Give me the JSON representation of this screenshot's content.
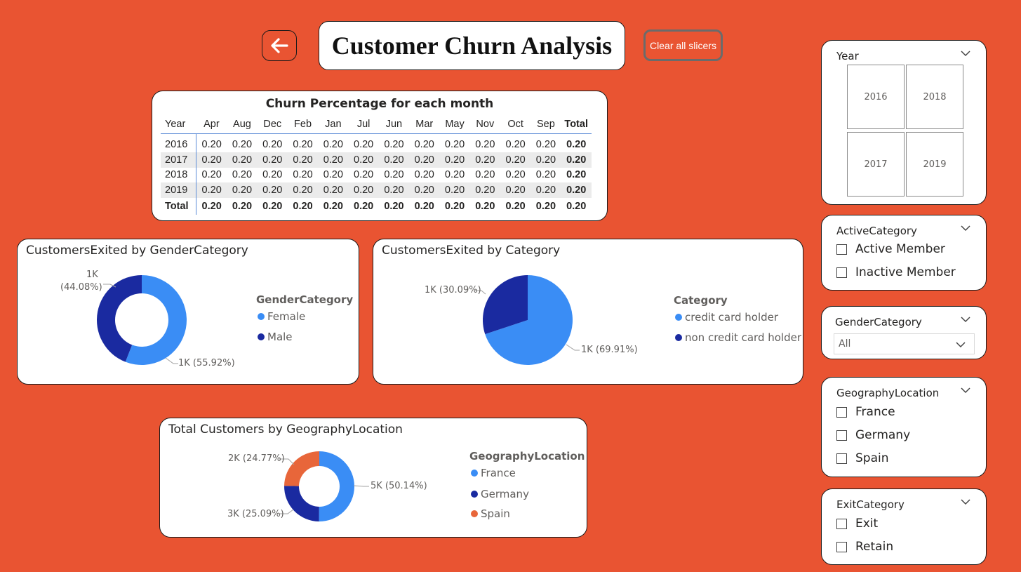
{
  "header": {
    "back_icon": "arrow-left-icon",
    "title": "Customer Churn Analysis",
    "clear_label": "Clear all slicers"
  },
  "matrix": {
    "title": "Churn Percentage for each month",
    "columns": [
      "Year",
      "Apr",
      "Aug",
      "Dec",
      "Feb",
      "Jan",
      "Jul",
      "Jun",
      "Mar",
      "May",
      "Nov",
      "Oct",
      "Sep",
      "Total"
    ],
    "rows": [
      {
        "label": "2016",
        "values": [
          "0.20",
          "0.20",
          "0.20",
          "0.20",
          "0.20",
          "0.20",
          "0.20",
          "0.20",
          "0.20",
          "0.20",
          "0.20",
          "0.20",
          "0.20"
        ]
      },
      {
        "label": "2017",
        "values": [
          "0.20",
          "0.20",
          "0.20",
          "0.20",
          "0.20",
          "0.20",
          "0.20",
          "0.20",
          "0.20",
          "0.20",
          "0.20",
          "0.20",
          "0.20"
        ]
      },
      {
        "label": "2018",
        "values": [
          "0.20",
          "0.20",
          "0.20",
          "0.20",
          "0.20",
          "0.20",
          "0.20",
          "0.20",
          "0.20",
          "0.20",
          "0.20",
          "0.20",
          "0.20"
        ]
      },
      {
        "label": "2019",
        "values": [
          "0.20",
          "0.20",
          "0.20",
          "0.20",
          "0.20",
          "0.20",
          "0.20",
          "0.20",
          "0.20",
          "0.20",
          "0.20",
          "0.20",
          "0.20"
        ]
      }
    ],
    "total_row": {
      "label": "Total",
      "values": [
        "0.20",
        "0.20",
        "0.20",
        "0.20",
        "0.20",
        "0.20",
        "0.20",
        "0.20",
        "0.20",
        "0.20",
        "0.20",
        "0.20",
        "0.20"
      ]
    }
  },
  "chart_data": [
    {
      "type": "pie",
      "variant": "donut",
      "title": "CustomersExited by GenderCategory",
      "legend_title": "GenderCategory",
      "categories": [
        "Female",
        "Male"
      ],
      "values": [
        55.92,
        44.08
      ],
      "data_labels": [
        "1K (55.92%)",
        "1K (44.08%)"
      ],
      "colors": [
        "#3A8DF5",
        "#1A2AA0"
      ]
    },
    {
      "type": "pie",
      "title": "CustomersExited by Category",
      "legend_title": "Category",
      "categories": [
        "credit card holder",
        "non credit card holder"
      ],
      "values": [
        69.91,
        30.09
      ],
      "data_labels": [
        "1K (69.91%)",
        "1K (30.09%)"
      ],
      "colors": [
        "#3A8DF5",
        "#1A2AA0"
      ]
    },
    {
      "type": "pie",
      "variant": "donut",
      "title": "Total Customers by GeographyLocation",
      "legend_title": "GeographyLocation",
      "categories": [
        "France",
        "Germany",
        "Spain"
      ],
      "values": [
        50.14,
        25.09,
        24.77
      ],
      "data_labels": [
        "5K (50.14%)",
        "3K (25.09%)",
        "2K (24.77%)"
      ],
      "colors": [
        "#3A8DF5",
        "#1A2AA0",
        "#E8663A"
      ]
    }
  ],
  "gender_labels": {
    "male_count": "1K",
    "male_pct": "(44.08%)"
  },
  "slicers": {
    "year": {
      "title": "Year",
      "tiles": [
        "2016",
        "2018",
        "2017",
        "2019"
      ]
    },
    "active": {
      "title": "ActiveCategory",
      "options": [
        "Active Member",
        "Inactive Member"
      ]
    },
    "gender": {
      "title": "GenderCategory",
      "selected": "All"
    },
    "geography": {
      "title": "GeographyLocation",
      "options": [
        "France",
        "Germany",
        "Spain"
      ]
    },
    "exit": {
      "title": "ExitCategory",
      "options": [
        "Exit",
        "Retain"
      ]
    }
  },
  "colors": {
    "background": "#E95432",
    "accent_blue": "#3A8DF5",
    "dark_blue": "#1A2AA0",
    "orange": "#E8663A"
  }
}
